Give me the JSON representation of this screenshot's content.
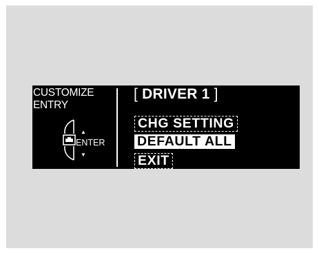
{
  "left_panel": {
    "line1": "CUSTOMIZE",
    "line2": "ENTRY",
    "enter_label": "ENTER",
    "up_arrow": "▲",
    "down_arrow": "▼",
    "dial_icon": "selector-dial-icon"
  },
  "header": {
    "open_bracket": "[",
    "title": "DRIVER 1",
    "close_bracket": "]"
  },
  "menu": {
    "items": [
      {
        "label": "CHG SETTING",
        "selected": false
      },
      {
        "label": "DEFAULT ALL",
        "selected": true
      },
      {
        "label": "EXIT",
        "selected": false
      }
    ]
  },
  "colors": {
    "background": "#dcdcdc",
    "screen": "#000000",
    "text": "#ffffff"
  }
}
